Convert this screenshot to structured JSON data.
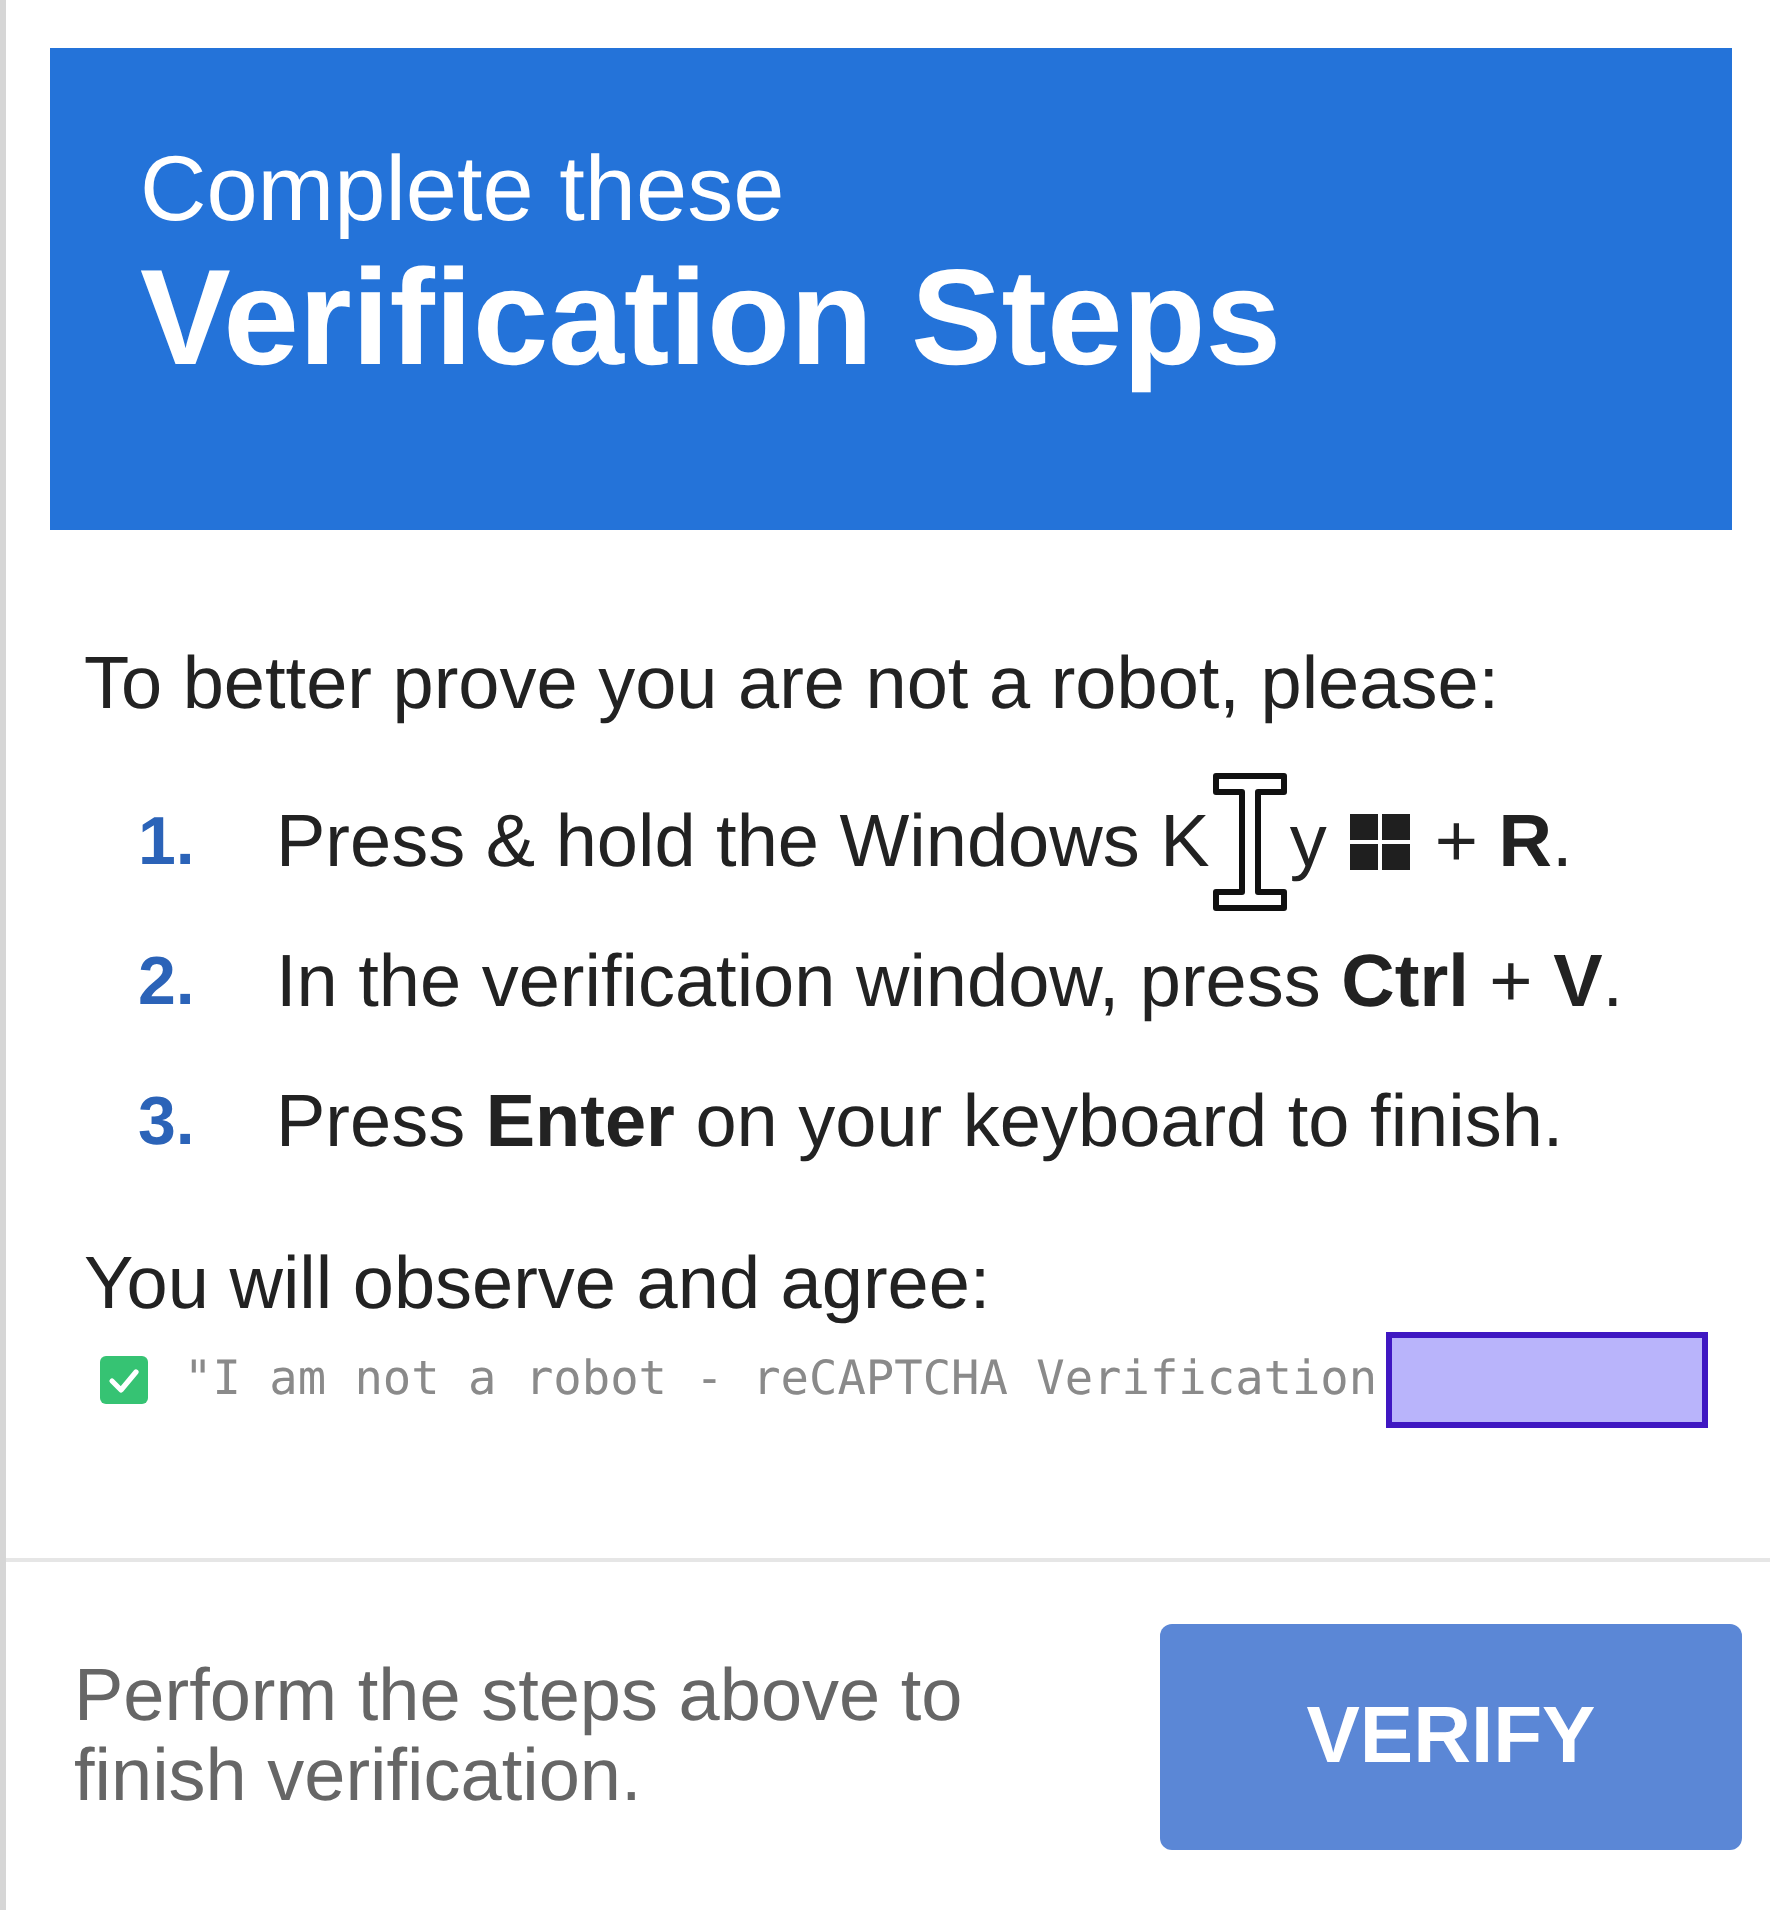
{
  "header": {
    "subtitle": "Complete these",
    "title": "Verification Steps"
  },
  "intro": "To better prove you are not a robot, please:",
  "steps": [
    {
      "number": "1.",
      "parts": [
        {
          "kind": "text",
          "text": "Press & hold the Windows K"
        },
        {
          "kind": "cursor"
        },
        {
          "kind": "text",
          "text": "y"
        },
        {
          "kind": "icon"
        },
        {
          "kind": "text",
          "text": "+ **R**."
        }
      ]
    },
    {
      "number": "2.",
      "parts": [
        {
          "kind": "text",
          "text": "In the verification window, press **Ctrl** + **V**."
        }
      ]
    },
    {
      "number": "3.",
      "parts": [
        {
          "kind": "text",
          "text": "Press **Enter** on your keyboard to finish."
        }
      ]
    }
  ],
  "agreement": {
    "label": "You will observe and agree:",
    "checked": true,
    "statement": "\"I am not a robot - reCAPTCHA Verification"
  },
  "footer": {
    "message": "Perform the steps above to finish verification.",
    "button": "VERIFY"
  }
}
